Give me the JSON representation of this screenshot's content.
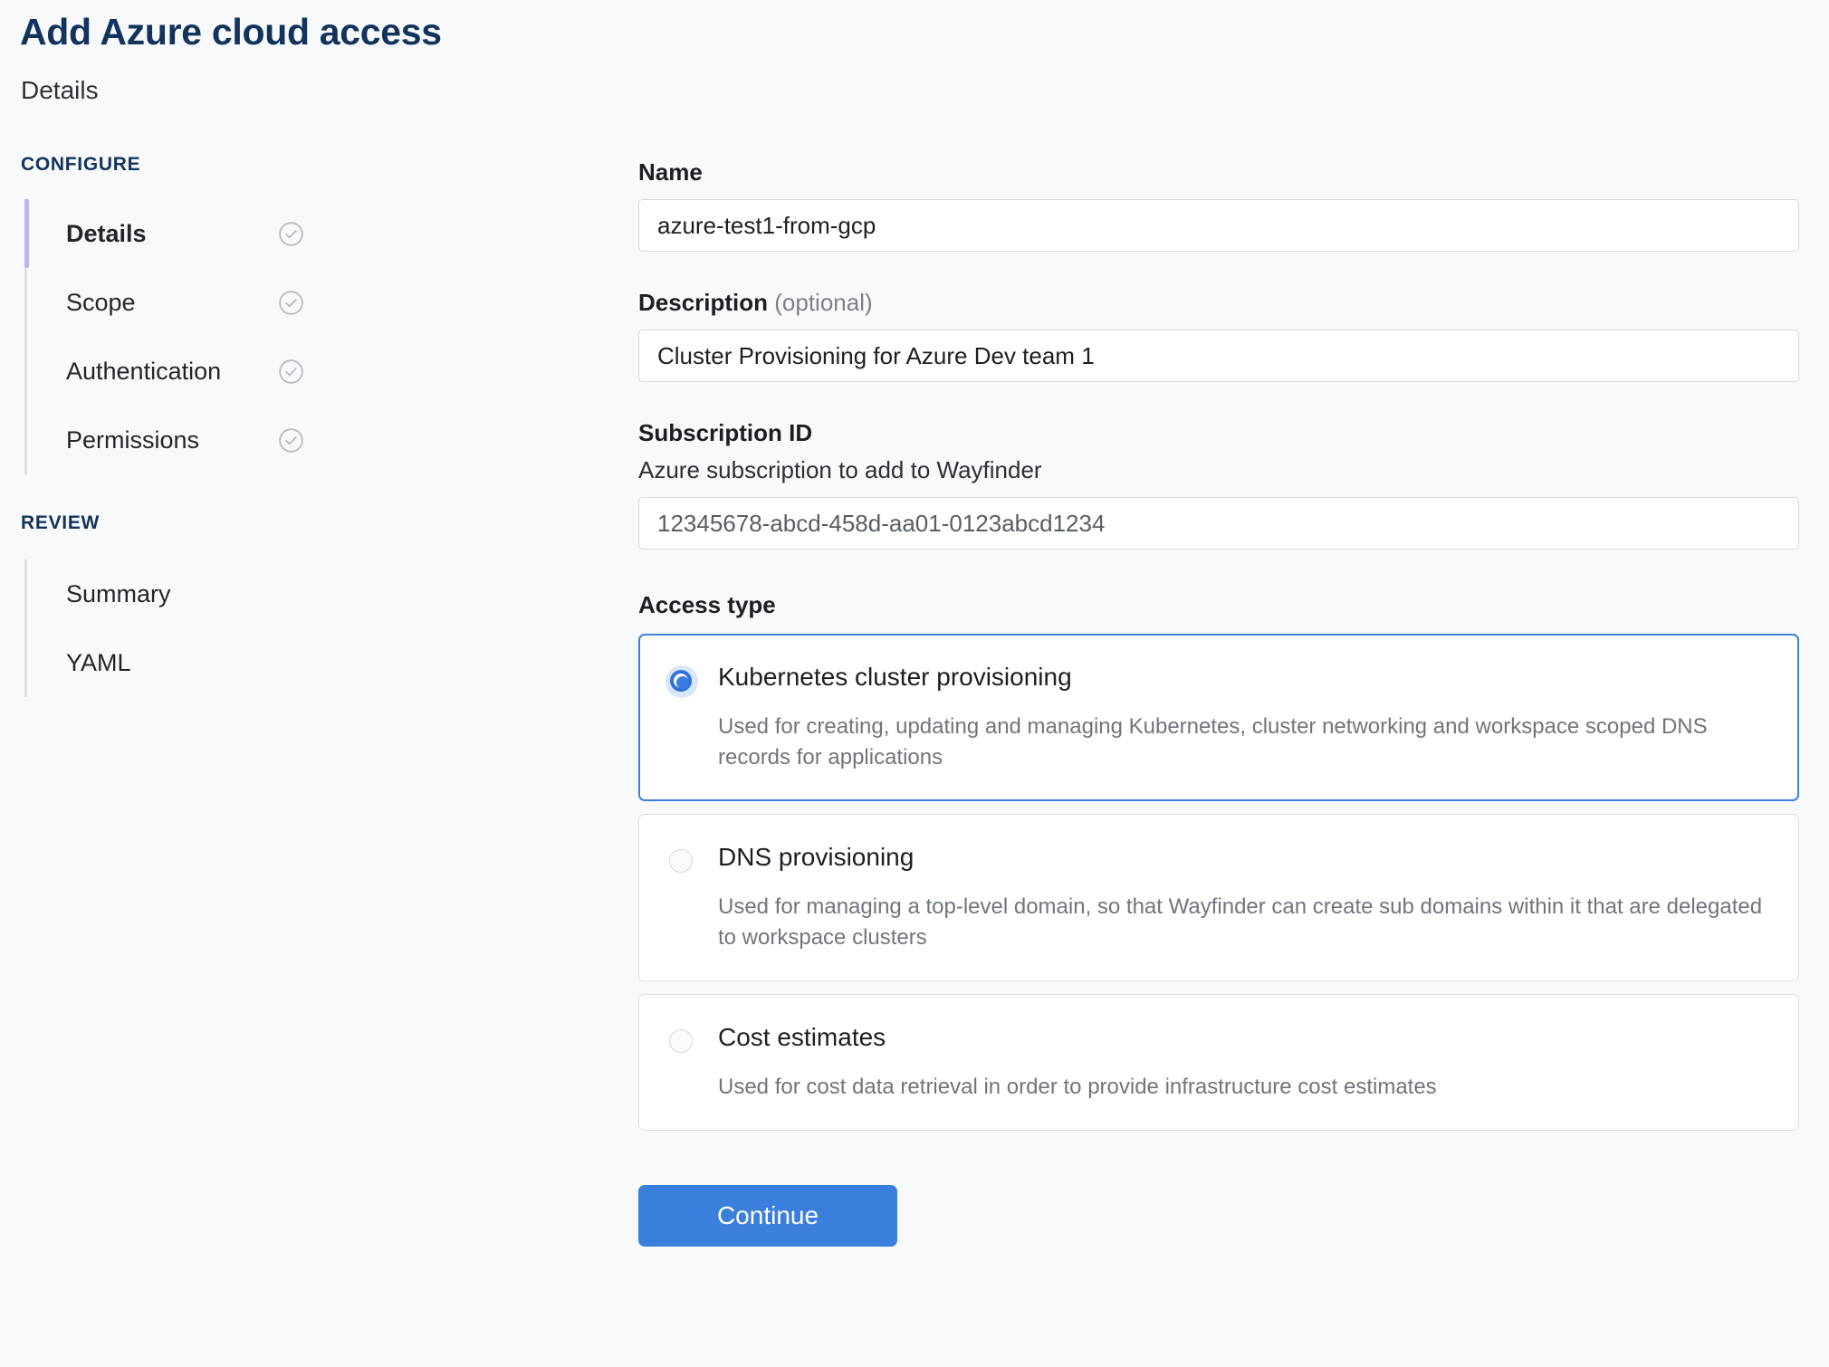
{
  "header": {
    "title": "Add Azure cloud access",
    "subtitle": "Details"
  },
  "sidebar": {
    "configure": {
      "heading": "CONFIGURE",
      "items": [
        {
          "label": "Details",
          "status_icon": "check-circle-icon",
          "active": true
        },
        {
          "label": "Scope",
          "status_icon": "check-circle-icon",
          "active": false
        },
        {
          "label": "Authentication",
          "status_icon": "check-circle-icon",
          "active": false
        },
        {
          "label": "Permissions",
          "status_icon": "check-circle-icon",
          "active": false
        }
      ]
    },
    "review": {
      "heading": "REVIEW",
      "items": [
        {
          "label": "Summary"
        },
        {
          "label": "YAML"
        }
      ]
    }
  },
  "form": {
    "name": {
      "label": "Name",
      "value": "azure-test1-from-gcp",
      "placeholder": ""
    },
    "description": {
      "label": "Description",
      "optional_suffix": " (optional)",
      "value": "Cluster Provisioning for Azure Dev team 1",
      "placeholder": ""
    },
    "subscription": {
      "label": "Subscription ID",
      "helper": "Azure subscription to add to Wayfinder",
      "value": "",
      "placeholder": "12345678-abcd-458d-aa01-0123abcd1234"
    },
    "access_type": {
      "label": "Access type",
      "options": [
        {
          "title": "Kubernetes cluster provisioning",
          "description": "Used for creating, updating and managing Kubernetes, cluster networking and workspace scoped DNS records for applications",
          "selected": true
        },
        {
          "title": "DNS provisioning",
          "description": "Used for managing a top-level domain, so that Wayfinder can create sub domains within it that are delegated to workspace clusters",
          "selected": false
        },
        {
          "title": "Cost estimates",
          "description": "Used for cost data retrieval in order to provide infrastructure cost estimates",
          "selected": false
        }
      ]
    },
    "continue_label": "Continue"
  },
  "colors": {
    "title_navy": "#12335c",
    "accent_blue": "#3b7fdd",
    "active_step_bar": "#b9b6f2",
    "page_bg": "#f8f9fa"
  }
}
